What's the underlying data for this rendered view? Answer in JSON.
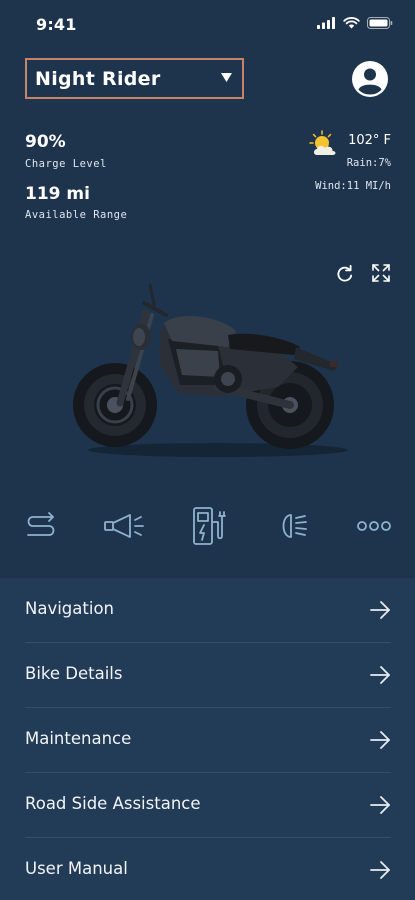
{
  "status_bar": {
    "time": "9:41"
  },
  "bike": {
    "name": "Night Rider"
  },
  "stats": {
    "charge_value": "90%",
    "charge_label": "Charge Level",
    "range_value": "119 mi",
    "range_label": "Available Range"
  },
  "weather": {
    "temperature": "102° F",
    "rain": "Rain:7%",
    "wind": "Wind:11 MI/h",
    "icon": "partly-sunny-icon"
  },
  "controls": [
    {
      "icon": "route-icon"
    },
    {
      "icon": "horn-icon"
    },
    {
      "icon": "charging-station-icon"
    },
    {
      "icon": "headlight-icon"
    },
    {
      "icon": "more-icon"
    }
  ],
  "menu": {
    "items": [
      {
        "label": "Navigation"
      },
      {
        "label": "Bike Details"
      },
      {
        "label": "Maintenance"
      },
      {
        "label": "Road Side Assistance"
      },
      {
        "label": "User Manual"
      }
    ]
  },
  "colors": {
    "background": "#1e344d",
    "menu_background": "#223b56",
    "selector_border": "#c8826a",
    "icon_stroke": "#8fb2cf"
  }
}
